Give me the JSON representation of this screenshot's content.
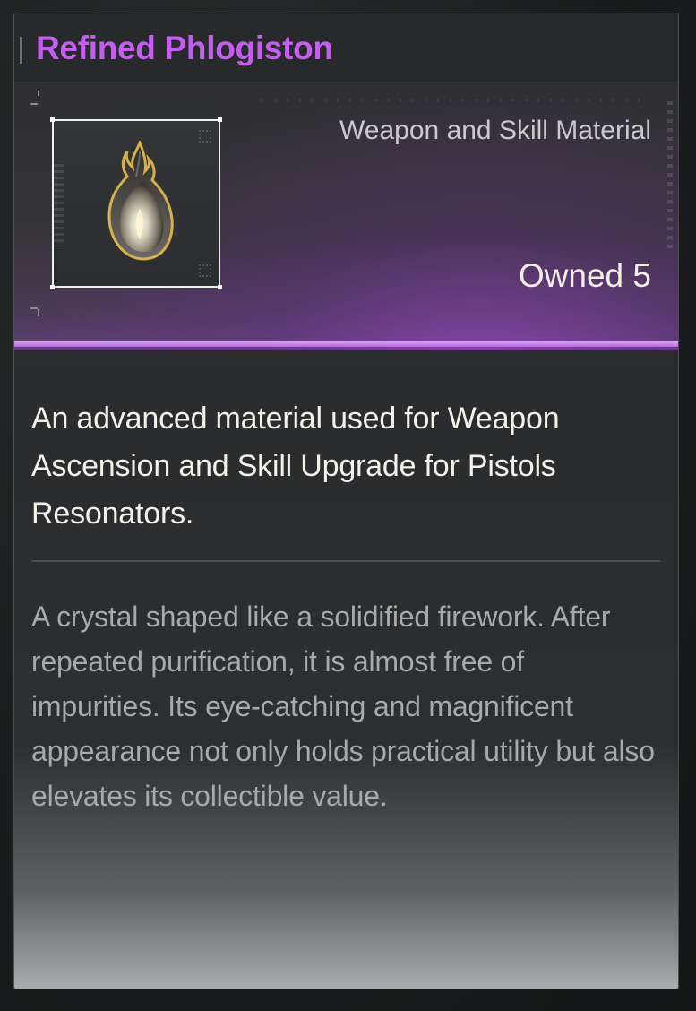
{
  "item": {
    "name": "Refined Phlogiston",
    "category": "Weapon and Skill Material",
    "owned_label": "Owned 5",
    "owned_count": 5,
    "rarity_color": "#c55df1",
    "icon": "phlogiston-crystal-icon"
  },
  "description": {
    "summary": "An advanced material used for Weapon Ascension and Skill Upgrade for Pistols Resonators.",
    "lore": "A crystal shaped like a solidified firework. After repeated purification, it is almost free of impurities. Its eye-catching and magnificent appearance not only holds practical utility but also elevates its collectible value."
  }
}
